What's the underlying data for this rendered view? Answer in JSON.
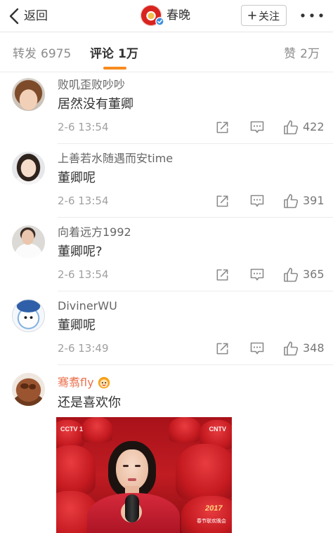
{
  "nav": {
    "back_label": "返回",
    "title": "春晚",
    "follow_label": "关注",
    "icons": {
      "back": "chevron-left-icon",
      "verified": "verified-badge-icon",
      "follow": "plus-icon",
      "more": "more-icon"
    }
  },
  "tabs": [
    {
      "label": "转发",
      "count": "6975",
      "active": false
    },
    {
      "label": "评论",
      "count": "1万",
      "active": true
    },
    {
      "label": "赞",
      "count": "2万",
      "active": false
    }
  ],
  "comments": [
    {
      "name": "败叽歪败吵吵",
      "text": "居然没有董卿",
      "time": "2-6 13:54",
      "likes": "422"
    },
    {
      "name": "上善若水随遇而安time",
      "text": "董卿呢",
      "time": "2-6 13:54",
      "likes": "391"
    },
    {
      "name": "向着远方1992",
      "text": "董卿呢?",
      "time": "2-6 13:54",
      "likes": "365"
    },
    {
      "name": "DivinerWU",
      "text": "董卿呢",
      "time": "2-6 13:49",
      "likes": "348"
    },
    {
      "name": "骞翥fly",
      "badge_icon": "member-badge-icon",
      "text": "还是喜欢你",
      "image": {
        "channel_logo": "CCTV 1",
        "site_logo": "CNTV",
        "year": "2017",
        "program": "春节联欢晚会"
      }
    }
  ],
  "comment_action_icons": [
    "forward-icon",
    "comment-icon",
    "like-icon"
  ],
  "colors": {
    "accent": "#f78b1f",
    "member_name": "#eb7350",
    "verified": "#3b8fe0",
    "text_primary": "#333333",
    "text_secondary": "#999999",
    "icon": "#8a8a8a"
  }
}
